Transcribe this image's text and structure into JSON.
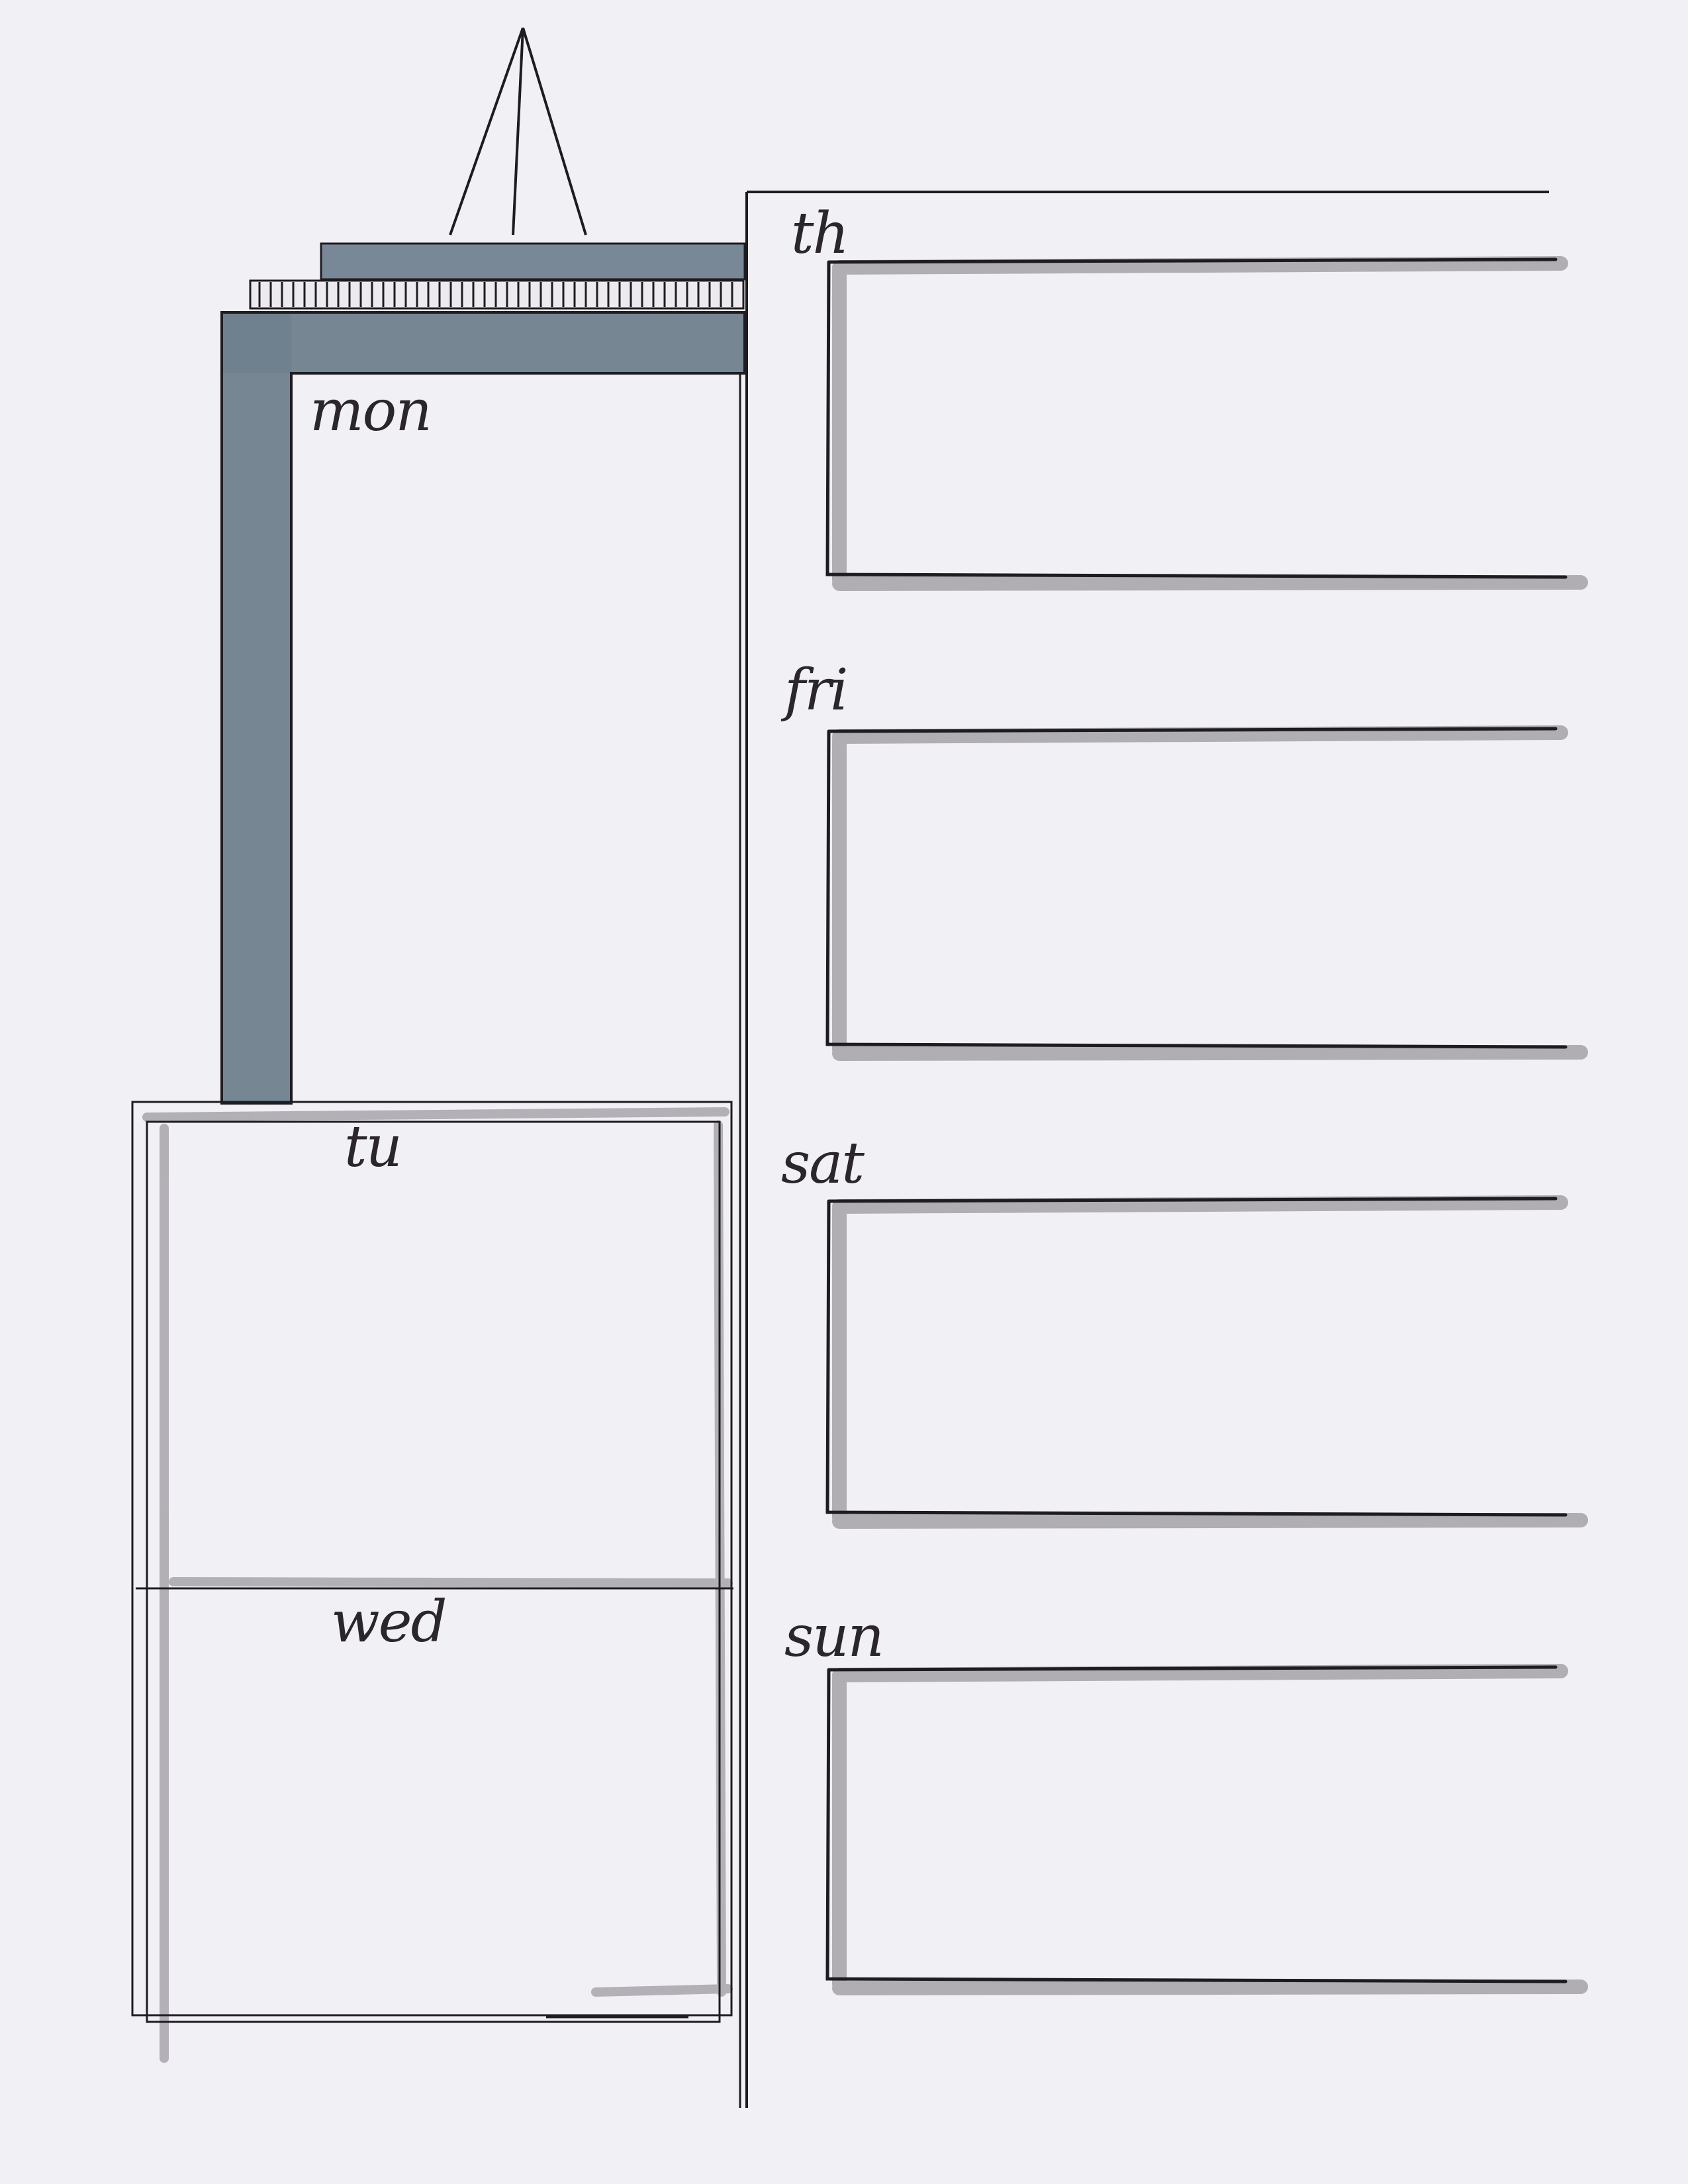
{
  "planner": {
    "labels": {
      "mon": "mon",
      "tu": "tu",
      "wed": "wed",
      "th": "th",
      "fri": "fri",
      "sat": "sat",
      "sun": "sun"
    }
  },
  "colors": {
    "paper": "#f1f0f4",
    "ink": "#1e1c20",
    "building_marker": "#6f7f8d",
    "shadow_marker": "#a8a6ab"
  }
}
